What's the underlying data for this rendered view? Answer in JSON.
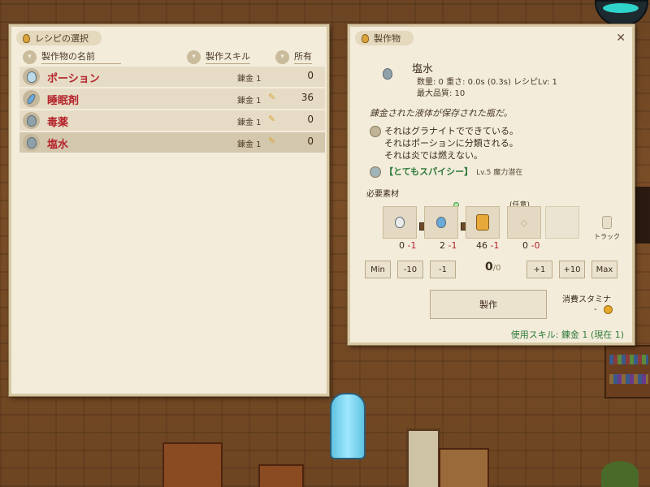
{
  "recipe_panel": {
    "tab_title": "レシピの選択",
    "columns": {
      "name": "製作物の名前",
      "skill": "製作スキル",
      "owned": "所有"
    },
    "rows": [
      {
        "name": "ポーション",
        "skill": "錬金 1",
        "owned": "0",
        "icon": "white-flask-icon",
        "checked": false
      },
      {
        "name": "睡眠剤",
        "skill": "錬金 1",
        "owned": "36",
        "icon": "blue-vial-icon",
        "checked": true
      },
      {
        "name": "毒薬",
        "skill": "錬金 1",
        "owned": "0",
        "icon": "gray-flask-icon",
        "checked": true
      },
      {
        "name": "塩水",
        "skill": "錬金 1",
        "owned": "0",
        "icon": "gray-flask-icon",
        "checked": true
      }
    ]
  },
  "craft_panel": {
    "tab_title": "製作物",
    "item": {
      "name": "塩水",
      "stats_line1": "数量: 0  重さ: 0.0s (0.3s)  レシピLv: 1",
      "stats_line2": "最大品質: 10",
      "description": "錬金された液体が保存された瓶だ。",
      "traits": [
        "それはグラナイトでできている。",
        "それはポーションに分類される。",
        "それは炎では燃えない。"
      ],
      "enchant": "【とてもスパイシー】",
      "enchant_level": "Lv.5 魔力潜在"
    },
    "materials": {
      "heading": "必要素材",
      "optional_label": "(任意)",
      "slots": [
        {
          "have": "0",
          "need": "-1",
          "icon": "empty-flask-icon"
        },
        {
          "have": "2",
          "need": "-1",
          "icon": "blue-flask-icon"
        },
        {
          "have": "46",
          "need": "-1",
          "icon": "salt-pouch-icon"
        },
        {
          "have": "0",
          "need": "-0",
          "icon": "optional-material-icon"
        }
      ],
      "track_label": "トラック"
    },
    "quantity": {
      "min": "Min",
      "minus10": "-10",
      "minus1": "-1",
      "value": "0",
      "max_value": "/0",
      "plus1": "+1",
      "plus10": "+10",
      "max": "Max"
    },
    "craft_button": "製作",
    "stamina_label": "消費スタミナ",
    "stamina_value": "-",
    "skill_used": "使用スキル: 錬金 1 (現在 1)"
  },
  "colors": {
    "panel_bg": "#f3ecdb",
    "item_name_red": "#b4232a",
    "enchant_green": "#2f7a3a",
    "quantity_need_red": "#b4232a"
  }
}
